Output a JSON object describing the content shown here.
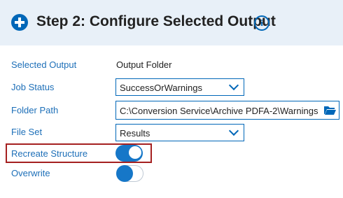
{
  "header": {
    "title": "Step 2: Configure Selected Output",
    "info_glyph": "i"
  },
  "fields": {
    "selected_output": {
      "label": "Selected Output",
      "value": "Output Folder"
    },
    "job_status": {
      "label": "Job Status",
      "value": "SuccessOrWarnings"
    },
    "folder_path": {
      "label": "Folder Path",
      "value": "C:\\Conversion Service\\Archive PDFA-2\\Warnings"
    },
    "file_set": {
      "label": "File Set",
      "value": "Results"
    },
    "recreate_structure": {
      "label": "Recreate Structure",
      "enabled": true
    },
    "overwrite": {
      "label": "Overwrite",
      "enabled": false
    }
  },
  "icons": {
    "header": "plus-circle-icon",
    "info": "info-icon",
    "folder": "folder-open-icon"
  },
  "colors": {
    "accent": "#0067b8",
    "label": "#1d6fb8",
    "highlight": "#a52020",
    "header_bg": "#e8f0f8"
  }
}
